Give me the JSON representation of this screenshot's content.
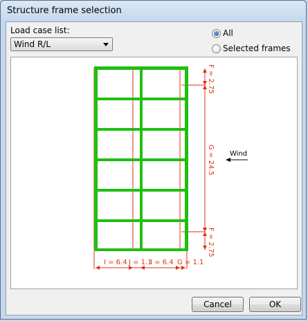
{
  "window": {
    "title": "Structure frame selection"
  },
  "load_case": {
    "label": "Load case list:",
    "selected": "Wind R/L"
  },
  "radios": [
    {
      "label": "All",
      "checked": true
    },
    {
      "label": "Selected frames",
      "checked": false
    }
  ],
  "diagram": {
    "dims_right": [
      "F = 2.75",
      "G = 24.5",
      "F = 2.75"
    ],
    "dims_bottom": [
      "I = 6.4",
      "J = 1.1",
      "I = 6.4",
      "G = 1.1"
    ],
    "wind_label": "Wind",
    "colors": {
      "frame": "#1fbf10",
      "dims": "#e03010"
    }
  },
  "buttons": {
    "cancel": "Cancel",
    "ok": "OK"
  }
}
